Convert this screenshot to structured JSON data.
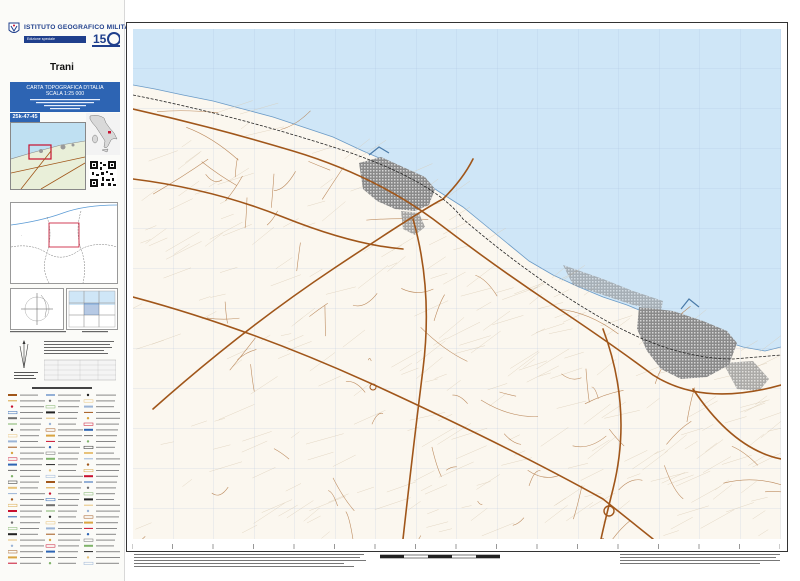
{
  "header": {
    "institute": "ISTITUTO GEOGRAFICO MILITARE",
    "edition": "Edizione speciale"
  },
  "map_title": "Trani",
  "panel": {
    "line1": "CARTA TOPOGRAFICA D'ITALIA",
    "line2": "SCALA 1:25 000"
  },
  "sheet_id": "25k-47-45",
  "colors": {
    "sea": "#cfe6f7",
    "land": "#fbf7ef",
    "roads": "#a0561a",
    "urban": "#6e6e6e",
    "brand": "#2d64b3"
  },
  "icons": [
    "ign-logo",
    "anniversary-logo",
    "italy-locator-map",
    "qr-code",
    "north-arrow-diagram"
  ]
}
